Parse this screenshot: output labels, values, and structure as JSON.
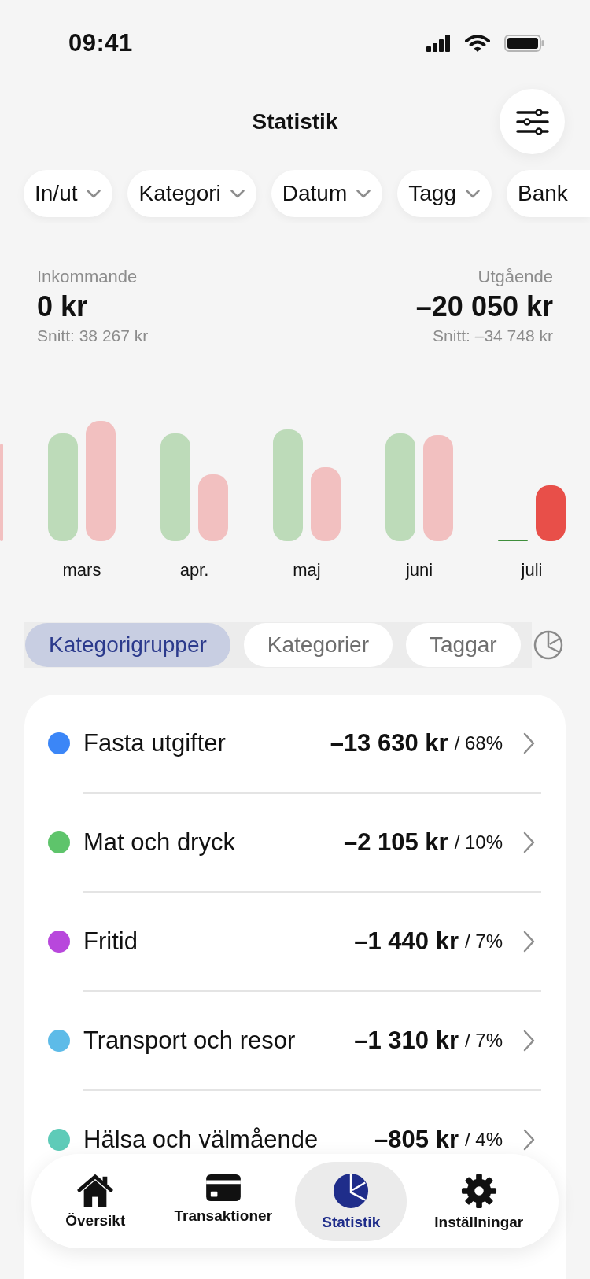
{
  "status_bar": {
    "time": "09:41"
  },
  "header": {
    "title": "Statistik"
  },
  "filters": [
    {
      "label": "In/ut",
      "caret": true
    },
    {
      "label": "Kategori",
      "caret": true
    },
    {
      "label": "Datum",
      "caret": true
    },
    {
      "label": "Tagg",
      "caret": true
    },
    {
      "label": "Bank",
      "caret": false
    }
  ],
  "summary": {
    "incoming": {
      "label": "Inkommande",
      "amount": "0 kr",
      "average": "Snitt: 38 267 kr"
    },
    "outgoing": {
      "label": "Utgående",
      "amount": "–20 050 kr",
      "average": "Snitt: –34 748 kr"
    }
  },
  "chart": {
    "months": [
      {
        "label": "mars",
        "selected": false
      },
      {
        "label": "apr.",
        "selected": false
      },
      {
        "label": "maj",
        "selected": false
      },
      {
        "label": "juni",
        "selected": false
      },
      {
        "label": "juli",
        "selected": true
      }
    ]
  },
  "segments": [
    {
      "label": "Kategorigrupper",
      "selected": true
    },
    {
      "label": "Kategorier",
      "selected": false
    },
    {
      "label": "Taggar",
      "selected": false
    }
  ],
  "groups": [
    {
      "name": "Fasta utgifter",
      "amount": "–13 630 kr",
      "share": "/ 68%",
      "color": "#3b86f7"
    },
    {
      "name": "Mat och dryck",
      "amount": "–2 105 kr",
      "share": "/ 10%",
      "color": "#5ec46b"
    },
    {
      "name": "Fritid",
      "amount": "–1 440 kr",
      "share": "/ 7%",
      "color": "#b847dc"
    },
    {
      "name": "Transport och resor",
      "amount": "–1 310 kr",
      "share": "/ 7%",
      "color": "#5dbbe8"
    },
    {
      "name": "Hälsa och välmående",
      "amount": "–805 kr",
      "share": "/ 4%",
      "color": "#5ecbb8"
    }
  ],
  "nav": [
    {
      "label": "Översikt",
      "selected": false
    },
    {
      "label": "Transaktioner",
      "selected": false
    },
    {
      "label": "Statistik",
      "selected": true
    },
    {
      "label": "Inställningar",
      "selected": false
    }
  ]
}
